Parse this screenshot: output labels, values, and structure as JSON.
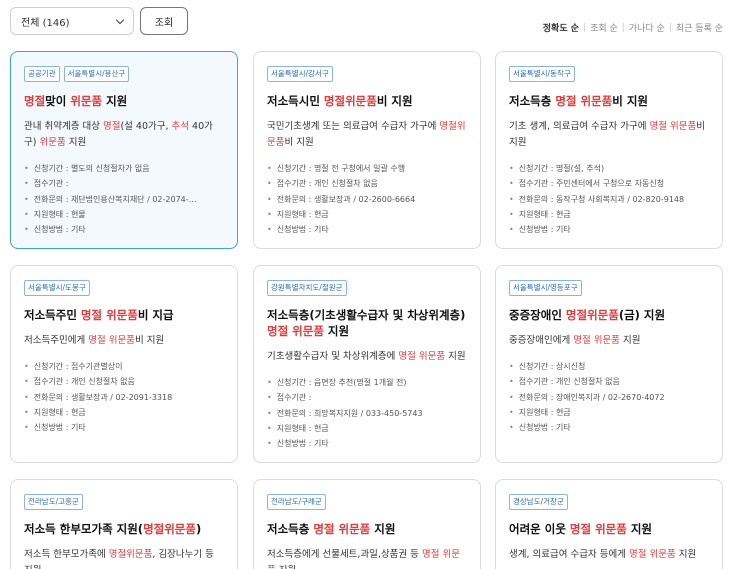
{
  "filter": {
    "selected": "전체 (146)"
  },
  "search_button": "조회",
  "sort": {
    "options": [
      "정확도 순",
      "조회 순",
      "가나다 순",
      "최근 등록 순"
    ]
  },
  "meta_labels": {
    "period": "신청기간 :",
    "place": "접수기관 :",
    "contact": "전화문의 :",
    "type": "지원형태 :",
    "method": "신청방법 :"
  },
  "cards": [
    {
      "tags": [
        "공공기관",
        "서울특별시/용산구"
      ],
      "title": [
        {
          "t": "명절",
          "h": true
        },
        {
          "t": "맞이 ",
          "h": false
        },
        {
          "t": "위문품",
          "h": true
        },
        {
          "t": " 지원",
          "h": false
        }
      ],
      "desc": [
        {
          "t": "관내 취약계층 대상 ",
          "h": false
        },
        {
          "t": "명절",
          "h": true
        },
        {
          "t": "(설 40가구, ",
          "h": false
        },
        {
          "t": "추석",
          "h": true
        },
        {
          "t": " 40가구) ",
          "h": false
        },
        {
          "t": "위문품",
          "h": true
        },
        {
          "t": " 지원",
          "h": false
        }
      ],
      "period": "별도의 신청절차가 없음",
      "place": "",
      "contact": "재단법인용산복지재단 / 02-2074-…",
      "type": "현물",
      "method": "기타"
    },
    {
      "tags": [
        "서울특별시/강서구"
      ],
      "title": [
        {
          "t": "저소득시민 ",
          "h": false
        },
        {
          "t": "명절위문품",
          "h": true
        },
        {
          "t": "비 지원",
          "h": false
        }
      ],
      "desc": [
        {
          "t": "국민기초생계 또는 의료급여 수급자 가구에 ",
          "h": false
        },
        {
          "t": "명절위문품",
          "h": true
        },
        {
          "t": "비 지원",
          "h": false
        }
      ],
      "period": "명절 전 구청에서 일괄 수행",
      "place": "개인 신청절차 없음",
      "contact": "생활보장과 / 02-2600-6664",
      "type": "현금",
      "method": "기타"
    },
    {
      "tags": [
        "서울특별시/동작구"
      ],
      "title": [
        {
          "t": "저소득층 ",
          "h": false
        },
        {
          "t": "명절 위문품",
          "h": true
        },
        {
          "t": "비 지원",
          "h": false
        }
      ],
      "desc": [
        {
          "t": "기초 생계, 의료급여 수급자 가구에 ",
          "h": false
        },
        {
          "t": "명절 위문품",
          "h": true
        },
        {
          "t": "비 지원",
          "h": false
        }
      ],
      "period": "명절(설, 추석)",
      "place": "주민센터에서 구청으로 자동신청",
      "contact": "동작구청 사회복지과 / 02-820-9148",
      "type": "현금",
      "method": "기타"
    },
    {
      "tags": [
        "서울특별시/도봉구"
      ],
      "title": [
        {
          "t": "저소득주민 ",
          "h": false
        },
        {
          "t": "명절 위문품",
          "h": true
        },
        {
          "t": "비 지급",
          "h": false
        }
      ],
      "desc": [
        {
          "t": "저소득주민에게 ",
          "h": false
        },
        {
          "t": "명절 위문품",
          "h": true
        },
        {
          "t": "비 지원",
          "h": false
        }
      ],
      "period": "접수기관별상이",
      "place": "개인 신청절차 없음",
      "contact": "생활보장과 / 02-2091-3318",
      "type": "현금",
      "method": "기타"
    },
    {
      "tags": [
        "강원특별자치도/철원군"
      ],
      "title": [
        {
          "t": "저소득층(기초생활수급자 및 차상위계층) ",
          "h": false
        },
        {
          "t": "명절 위문품",
          "h": true
        },
        {
          "t": " 지원",
          "h": false
        }
      ],
      "desc": [
        {
          "t": "기초생활수급자 및 차상위계층에 ",
          "h": false
        },
        {
          "t": "명절 위문품",
          "h": true
        },
        {
          "t": " 지원",
          "h": false
        }
      ],
      "period": "읍면장 추천(명절 1개월 전)",
      "place": "",
      "contact": "희망복지지원 / 033-450-5743",
      "type": "현금",
      "method": "기타"
    },
    {
      "tags": [
        "서울특별시/영등포구"
      ],
      "title": [
        {
          "t": "중증장애인 ",
          "h": false
        },
        {
          "t": "명절위문품",
          "h": true
        },
        {
          "t": "(금) 지원",
          "h": false
        }
      ],
      "desc": [
        {
          "t": "중증장애인에게 ",
          "h": false
        },
        {
          "t": "명절 위문품",
          "h": true
        },
        {
          "t": " 지원",
          "h": false
        }
      ],
      "period": "상시신청",
      "place": "개인 신청절차 없음",
      "contact": "장애인복지과 / 02-2670-4072",
      "type": "현금",
      "method": "기타"
    },
    {
      "tags": [
        "전라남도/고흥군"
      ],
      "title": [
        {
          "t": "저소득 한부모가족 지원(",
          "h": false
        },
        {
          "t": "명절위문품",
          "h": true
        },
        {
          "t": ")",
          "h": false
        }
      ],
      "desc": [
        {
          "t": "저소득 한부모가족에 ",
          "h": false
        },
        {
          "t": "명절위문품",
          "h": true
        },
        {
          "t": ", 김장나누기 등 지원",
          "h": false
        }
      ]
    },
    {
      "tags": [
        "전라남도/구례군"
      ],
      "title": [
        {
          "t": "저소득층 ",
          "h": false
        },
        {
          "t": "명절 위문품",
          "h": true
        },
        {
          "t": " 지원",
          "h": false
        }
      ],
      "desc": [
        {
          "t": "저소득층에게 선물세트,과일,상품권 등 ",
          "h": false
        },
        {
          "t": "명절 위문품",
          "h": true
        },
        {
          "t": " 지원",
          "h": false
        }
      ]
    },
    {
      "tags": [
        "경상남도/거창군"
      ],
      "title": [
        {
          "t": "어려운 이웃 ",
          "h": false
        },
        {
          "t": "명절 위문품",
          "h": true
        },
        {
          "t": " 지원",
          "h": false
        }
      ],
      "desc": [
        {
          "t": "생계, 의료급여 수급자 등에게 ",
          "h": false
        },
        {
          "t": "명절 위문품",
          "h": true
        },
        {
          "t": " 지원",
          "h": false
        }
      ]
    }
  ]
}
